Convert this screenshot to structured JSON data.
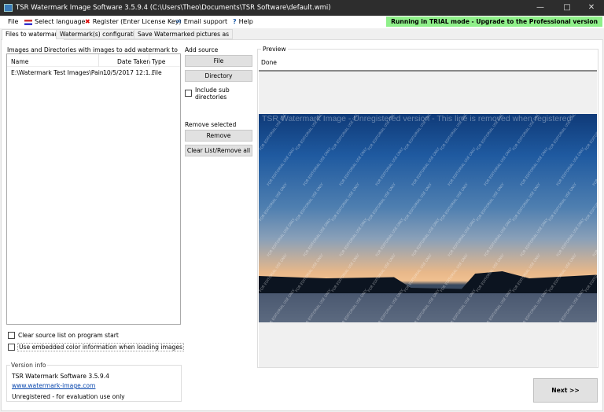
{
  "window": {
    "title": "TSR Watermark Image Software 3.5.9.4 (C:\\Users\\Theo\\Documents\\TSR Software\\default.wmi)"
  },
  "menu": {
    "file": "File",
    "language": "Select language",
    "register": "Register (Enter License Key)",
    "email": "Email support",
    "help": "Help"
  },
  "trial_banner": "Running in TRIAL mode - Upgrade to the Professional version",
  "tabs": [
    "Files to watermark",
    "Watermark(s) configuration",
    "Save Watermarked pictures as"
  ],
  "files": {
    "label": "Images and Directories with images to add watermark to",
    "columns": [
      "Name",
      "Date Taken",
      "Type"
    ],
    "rows": [
      {
        "name": "E:\\Watermark Test Images\\Pain...",
        "date": "10/5/2017 12:1...",
        "type": "File"
      }
    ]
  },
  "add_source": {
    "label": "Add source",
    "file": "File",
    "directory": "Directory",
    "include_sub": "Include sub directories"
  },
  "remove": {
    "label": "Remove selected",
    "remove": "Remove",
    "clear": "Clear List/Remove all"
  },
  "options": {
    "clear_on_start": "Clear source list on program start",
    "embedded_color": "Use embedded color information when loading images"
  },
  "version": {
    "label": "Version info",
    "name": "TSR Watermark Software 3.5.9.4",
    "url": "www.watermark-image.com",
    "status": "Unregistered - for evaluation use only"
  },
  "preview": {
    "label": "Preview",
    "status": "Done",
    "watermark_line": "TSR Watermark Image - Unregistered version - This line is removed when registered",
    "watermark_tile": "FOR EDITORIAL USE ONLY"
  },
  "next": "Next >>",
  "colors": {
    "trial": "#8ff08a",
    "titlebar": "#2d2d2d"
  }
}
